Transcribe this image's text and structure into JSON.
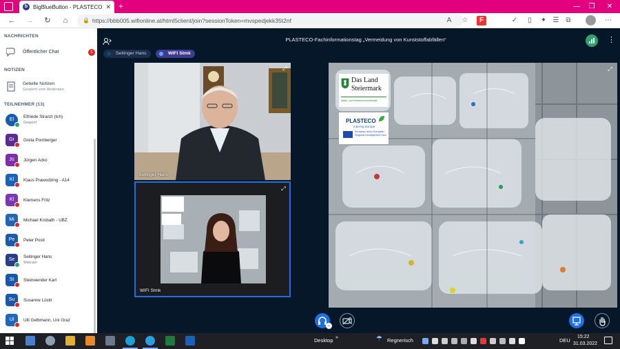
{
  "browser": {
    "tab_title": "BigBlueButton - PLASTECO",
    "tab_favicon": "b",
    "url": "https://bbb005.wifionline.at/html5client/join?sessionToken=mvspedjekk35t2nf",
    "new_tab": "+"
  },
  "sidebar": {
    "messages_header": "NACHRICHTEN",
    "public_chat_label": "Öffentlicher Chat",
    "public_chat_badge": "1",
    "notes_header": "NOTIZEN",
    "notes_label": "Geteilte Notizen",
    "notes_sub": "Gesperrt vom Moderator",
    "participants_header": "TEILNEHMER (13)",
    "participants": [
      {
        "initials": "El",
        "name": "Elfriede Stranzl (Ich)",
        "sub": "Gesperrt",
        "color": "#1d5aa8"
      },
      {
        "initials": "Gr",
        "name": "Greta Pomberger",
        "sub": "",
        "color": "#5b2d8c"
      },
      {
        "initials": "Jü",
        "name": "Jürgen Acko",
        "sub": "",
        "color": "#7b2fa8"
      },
      {
        "initials": "Kl",
        "name": "Klaus Prawodzing - A14",
        "sub": "",
        "color": "#1c61b8"
      },
      {
        "initials": "Kl",
        "name": "Klemens Fritz",
        "sub": "",
        "color": "#7a37b0"
      },
      {
        "initials": "Mi",
        "name": "Michael Krobath - UBZ",
        "sub": "",
        "color": "#2265b0"
      },
      {
        "initials": "Pe",
        "name": "Peter Postl",
        "sub": "",
        "color": "#1d5aa8"
      },
      {
        "initials": "Se",
        "name": "Seitinger Hans",
        "sub": "Webcam",
        "color": "#2a3e86"
      },
      {
        "initials": "St",
        "name": "Steinwender Karl",
        "sub": "",
        "color": "#1b57a8"
      },
      {
        "initials": "Su",
        "name": "Susanne Lückl",
        "sub": "",
        "color": "#1b57a8"
      },
      {
        "initials": "Ul",
        "name": "Ulli Gelbmann, Uni Graz",
        "sub": "",
        "color": "#2266b8"
      }
    ]
  },
  "meeting": {
    "title": "PLASTECO-Fachinformationstag „Vermeidung von Kunststoffabfällen“",
    "talkers": [
      {
        "name": "Seitinger Hans",
        "active": false
      },
      {
        "name": "WIFI Stmk",
        "active": true
      }
    ],
    "video1_name": "Seitinger Hans",
    "video2_name": "WIFI Stmk",
    "logo1_line1": "Das Land",
    "logo1_line2": "Steiermark",
    "logo1_sub": "Abfall- und Ressourcenwirtschaft",
    "logo2_title": "PLASTECO",
    "logo2_sub": "Interreg Europe",
    "logo2_eu": "European Union European Regional Development Fund"
  },
  "taskbar": {
    "desktop_label": "Desktop",
    "weather": "Regnerisch",
    "lang": "DEU",
    "time": "15:22",
    "date": "31.03.2022"
  },
  "colors": {
    "brand_magenta": "#e3007e",
    "meeting_bg": "#06172a",
    "accent_blue": "#1f6fe0"
  }
}
